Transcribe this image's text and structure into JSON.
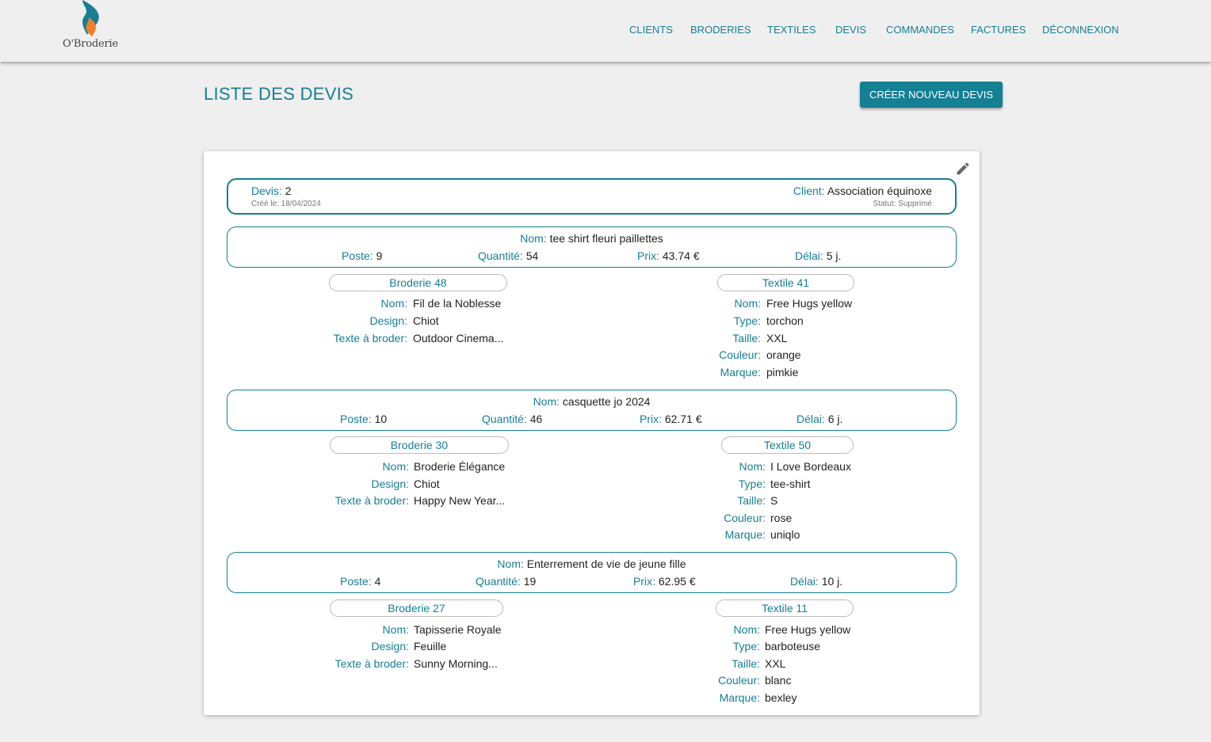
{
  "brand": {
    "logo_text": "O'Broderie"
  },
  "nav": [
    "CLIENTS",
    "BRODERIES",
    "TEXTILES",
    "DEVIS",
    "COMMANDES",
    "FACTURES",
    "DÉCONNEXION"
  ],
  "page": {
    "title": "LISTE DES DEVIS",
    "create_button": "CRÉER NOUVEAU DEVIS"
  },
  "colors": {
    "accent": "#157f93",
    "background": "#efefef",
    "card": "#ffffff"
  },
  "quote": {
    "devis_label": "Devis:",
    "devis_value": "2",
    "created": "Créé le: 18/04/2024",
    "client_label": "Client:",
    "client_value": "Association équinoxe",
    "status": "Statut: Supprimé"
  },
  "labels": {
    "nom": "Nom:",
    "poste": "Poste:",
    "quantite": "Quantité:",
    "prix": "Prix:",
    "delai": "Délai:",
    "design": "Design:",
    "texte": "Texte à broder:",
    "type": "Type:",
    "taille": "Taille:",
    "couleur": "Couleur:",
    "marque": "Marque:"
  },
  "lines": [
    {
      "nom": "tee shirt fleuri paillettes",
      "poste": "9",
      "quantite": "54",
      "prix": "43.74 €",
      "delai": "5 j.",
      "broderie": {
        "title": "Broderie 48",
        "nom": "Fil de la Noblesse",
        "design": "Chiot",
        "texte": "Outdoor Cinema..."
      },
      "textile": {
        "title": "Textile 41",
        "nom": "Free Hugs yellow",
        "type": "torchon",
        "taille": "XXL",
        "couleur": "orange",
        "marque": "pimkie"
      }
    },
    {
      "nom": "casquette jo 2024",
      "poste": "10",
      "quantite": "46",
      "prix": "62.71 €",
      "delai": "6 j.",
      "broderie": {
        "title": "Broderie 30",
        "nom": "Broderie Élégance",
        "design": "Chiot",
        "texte": "Happy New Year..."
      },
      "textile": {
        "title": "Textile 50",
        "nom": "I Love Bordeaux",
        "type": "tee-shirt",
        "taille": "S",
        "couleur": "rose",
        "marque": "uniqlo"
      }
    },
    {
      "nom": "Enterrement de vie de jeune fille",
      "poste": "4",
      "quantite": "19",
      "prix": "62.95 €",
      "delai": "10 j.",
      "broderie": {
        "title": "Broderie 27",
        "nom": "Tapisserie Royale",
        "design": "Feuille",
        "texte": "Sunny Morning..."
      },
      "textile": {
        "title": "Textile 11",
        "nom": "Free Hugs yellow",
        "type": "barboteuse",
        "taille": "XXL",
        "couleur": "blanc",
        "marque": "bexley"
      }
    }
  ],
  "icons": {
    "logo": "flame-logo-icon",
    "edit": "pencil-edit-icon"
  }
}
